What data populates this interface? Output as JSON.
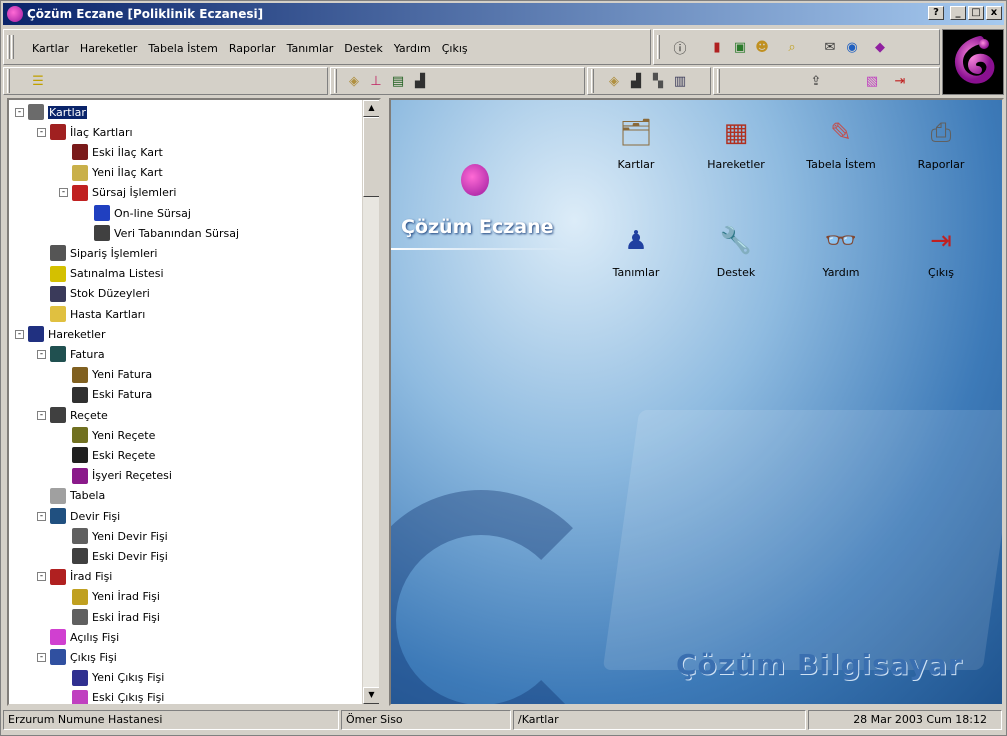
{
  "window": {
    "title": "Çözüm Eczane [Poliklinik Eczanesi]",
    "help": "?",
    "minimize": "_",
    "maximize": "□",
    "close": "x"
  },
  "menu": [
    "Kartlar",
    "Hareketler",
    "Tabela İstem",
    "Raporlar",
    "Tanımlar",
    "Destek",
    "Yardım",
    "Çıkış"
  ],
  "tree": [
    {
      "label": "Kartlar",
      "level": 0,
      "exp": "-",
      "icon": "pencil-icon",
      "color": "#6b6b6b",
      "selected": true
    },
    {
      "label": "İlaç Kartları",
      "level": 1,
      "exp": "-",
      "icon": "card-icon",
      "color": "#a02020"
    },
    {
      "label": "Eski İlaç Kart",
      "level": 2,
      "exp": "",
      "icon": "card-icon",
      "color": "#7a1a1a"
    },
    {
      "label": "Yeni İlaç Kart",
      "level": 2,
      "exp": "",
      "icon": "diamond-icon",
      "color": "#c9b04a"
    },
    {
      "label": "Sürsaj İşlemleri",
      "level": 2,
      "exp": "-",
      "icon": "grid-icon",
      "color": "#c02020"
    },
    {
      "label": "On-line Sürsaj",
      "level": 3,
      "exp": "",
      "icon": "monitor-icon",
      "color": "#2040c0"
    },
    {
      "label": "Veri Tabanından Sürsaj",
      "level": 3,
      "exp": "",
      "icon": "database-icon",
      "color": "#404040"
    },
    {
      "label": "Sipariş İşlemleri",
      "level": 1,
      "exp": "",
      "icon": "order-icon",
      "color": "#555555"
    },
    {
      "label": "Satınalma Listesi",
      "level": 1,
      "exp": "",
      "icon": "list-icon",
      "color": "#d4c000"
    },
    {
      "label": "Stok Düzeyleri",
      "level": 1,
      "exp": "",
      "icon": "stock-icon",
      "color": "#3a3a5a"
    },
    {
      "label": "Hasta Kartları",
      "level": 1,
      "exp": "",
      "icon": "patient-icon",
      "color": "#e0c040"
    },
    {
      "label": "Hareketler",
      "level": 0,
      "exp": "-",
      "icon": "calculator-icon",
      "color": "#203080"
    },
    {
      "label": "Fatura",
      "level": 1,
      "exp": "-",
      "icon": "invoice-icon",
      "color": "#205050"
    },
    {
      "label": "Yeni Fatura",
      "level": 2,
      "exp": "",
      "icon": "invoice-icon",
      "color": "#806020"
    },
    {
      "label": "Eski Fatura",
      "level": 2,
      "exp": "",
      "icon": "invoice-icon",
      "color": "#303030"
    },
    {
      "label": "Reçete",
      "level": 1,
      "exp": "-",
      "icon": "prescription-icon",
      "color": "#404040"
    },
    {
      "label": "Yeni Reçete",
      "level": 2,
      "exp": "",
      "icon": "prescription-icon",
      "color": "#707020"
    },
    {
      "label": "Eski Reçete",
      "level": 2,
      "exp": "",
      "icon": "prescription-icon",
      "color": "#202020"
    },
    {
      "label": "İşyeri Reçetesi",
      "level": 2,
      "exp": "",
      "icon": "prescription-icon",
      "color": "#8a1a8a"
    },
    {
      "label": "Tabela",
      "level": 1,
      "exp": "",
      "icon": "tabela-icon",
      "color": "#a0a0a0"
    },
    {
      "label": "Devir Fişi",
      "level": 1,
      "exp": "-",
      "icon": "transfer-icon",
      "color": "#205080"
    },
    {
      "label": "Yeni Devir Fişi",
      "level": 2,
      "exp": "",
      "icon": "transfer-icon",
      "color": "#606060"
    },
    {
      "label": "Eski Devir Fişi",
      "level": 2,
      "exp": "",
      "icon": "transfer-icon",
      "color": "#404040"
    },
    {
      "label": "İrad Fişi",
      "level": 1,
      "exp": "-",
      "icon": "income-icon",
      "color": "#b02020"
    },
    {
      "label": "Yeni İrad Fişi",
      "level": 2,
      "exp": "",
      "icon": "income-icon",
      "color": "#c0a020"
    },
    {
      "label": "Eski İrad Fişi",
      "level": 2,
      "exp": "",
      "icon": "income-icon",
      "color": "#606060"
    },
    {
      "label": "Açılış Fişi",
      "level": 1,
      "exp": "",
      "icon": "opening-icon",
      "color": "#d040d0"
    },
    {
      "label": "Çıkış Fişi",
      "level": 1,
      "exp": "-",
      "icon": "exit-slip-icon",
      "color": "#3050a0"
    },
    {
      "label": "Yeni Çıkış Fişi",
      "level": 2,
      "exp": "",
      "icon": "exit-slip-icon",
      "color": "#303090"
    },
    {
      "label": "Eski Çıkış Fişi",
      "level": 2,
      "exp": "",
      "icon": "exit-slip-icon",
      "color": "#c040c0"
    }
  ],
  "desktop": {
    "brand": "Çözüm Eczane",
    "footer": "Çözüm Bilgisayar",
    "icons": [
      {
        "label": "Kartlar",
        "icon": "cards-icon",
        "glyph": "🗂",
        "color": "#8a6a3a"
      },
      {
        "label": "Hareketler",
        "icon": "calculator-icon",
        "glyph": "▦",
        "color": "#b03020"
      },
      {
        "label": "Tabela İstem",
        "icon": "pen-paper-icon",
        "glyph": "✎",
        "color": "#c05050"
      },
      {
        "label": "Raporlar",
        "icon": "printer-icon",
        "glyph": "⎙",
        "color": "#606060"
      },
      {
        "label": "Tanımlar",
        "icon": "person-icon",
        "glyph": "♟",
        "color": "#2040a0"
      },
      {
        "label": "Destek",
        "icon": "wrench-icon",
        "glyph": "🔧",
        "color": "#c040c0"
      },
      {
        "label": "Yardım",
        "icon": "help-book-icon",
        "glyph": "👓",
        "color": "#d0c020"
      },
      {
        "label": "Çıkış",
        "icon": "exit-door-icon",
        "glyph": "⇥",
        "color": "#c02020"
      }
    ]
  },
  "status": {
    "hospital": "Erzurum Numune Hastanesi",
    "user": "Ömer Siso",
    "path": "/Kartlar",
    "datetime": "28 Mar 2003 Cum  18:12"
  },
  "colors": {
    "title_start": "#0a246a",
    "title_end": "#a6caf0",
    "selection": "#0a246a"
  }
}
